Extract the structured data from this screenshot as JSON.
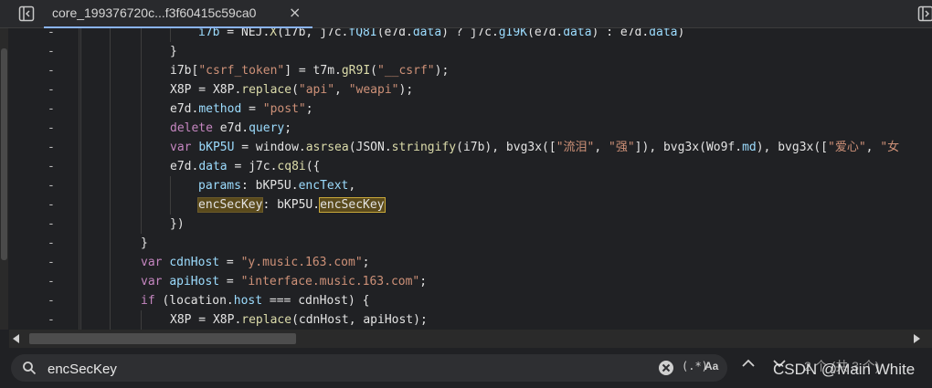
{
  "tab": {
    "title": "core_199376720c...f3f60415c59ca0",
    "close": "×"
  },
  "code_lines": [
    {
      "marker": "-",
      "tokens": [
        [
          "i7b",
          "var"
        ],
        [
          " = NEJ.",
          "plain"
        ],
        [
          "X",
          "fn"
        ],
        [
          "(i7b, j7c.",
          "plain"
        ],
        [
          "fQ8I",
          "prop"
        ],
        [
          "(e7d.",
          "plain"
        ],
        [
          "data",
          "prop"
        ],
        [
          ") ? j7c.",
          "plain"
        ],
        [
          "gI9K",
          "prop"
        ],
        [
          "(e7d.",
          "plain"
        ],
        [
          "data",
          "prop"
        ],
        [
          ") : e7d.",
          "plain"
        ],
        [
          "data",
          "prop"
        ],
        [
          ")",
          "plain"
        ]
      ]
    },
    {
      "marker": "-",
      "tokens": [
        [
          "}",
          "plain"
        ]
      ]
    },
    {
      "marker": "-",
      "tokens": [
        [
          "i7b[",
          "plain"
        ],
        [
          "\"csrf_token\"",
          "str"
        ],
        [
          "] = t7m.",
          "plain"
        ],
        [
          "gR9I",
          "fn"
        ],
        [
          "(",
          "plain"
        ],
        [
          "\"__csrf\"",
          "str"
        ],
        [
          ");",
          "plain"
        ]
      ]
    },
    {
      "marker": "-",
      "tokens": [
        [
          "X8P = X8P.",
          "plain"
        ],
        [
          "replace",
          "fn"
        ],
        [
          "(",
          "plain"
        ],
        [
          "\"api\"",
          "str"
        ],
        [
          ", ",
          "plain"
        ],
        [
          "\"weapi\"",
          "str"
        ],
        [
          ");",
          "plain"
        ]
      ]
    },
    {
      "marker": "-",
      "tokens": [
        [
          "e7d.",
          "plain"
        ],
        [
          "method",
          "prop"
        ],
        [
          " = ",
          "plain"
        ],
        [
          "\"post\"",
          "str"
        ],
        [
          ";",
          "plain"
        ]
      ]
    },
    {
      "marker": "-",
      "tokens": [
        [
          "delete",
          "kw"
        ],
        [
          " e7d.",
          "plain"
        ],
        [
          "query",
          "prop"
        ],
        [
          ";",
          "plain"
        ]
      ]
    },
    {
      "marker": "-",
      "tokens": [
        [
          "var",
          "kw"
        ],
        [
          " ",
          "plain"
        ],
        [
          "bKP5U",
          "var"
        ],
        [
          " = window.",
          "plain"
        ],
        [
          "asrsea",
          "fn"
        ],
        [
          "(JSON.",
          "plain"
        ],
        [
          "stringify",
          "fn"
        ],
        [
          "(i7b), bvg3x([",
          "plain"
        ],
        [
          "\"流泪\"",
          "str"
        ],
        [
          ", ",
          "plain"
        ],
        [
          "\"强\"",
          "str"
        ],
        [
          "]), bvg3x(Wo9f.",
          "plain"
        ],
        [
          "md",
          "prop"
        ],
        [
          "), bvg3x([",
          "plain"
        ],
        [
          "\"爱心\"",
          "str"
        ],
        [
          ", ",
          "plain"
        ],
        [
          "\"女",
          "str"
        ]
      ]
    },
    {
      "marker": "-",
      "tokens": [
        [
          "e7d.",
          "plain"
        ],
        [
          "data",
          "prop"
        ],
        [
          " = j7c.",
          "plain"
        ],
        [
          "cq8i",
          "fn"
        ],
        [
          "({",
          "plain"
        ]
      ]
    },
    {
      "marker": "-",
      "tokens": [
        [
          "params",
          "prop"
        ],
        [
          ": bKP5U.",
          "plain"
        ],
        [
          "encText",
          "prop"
        ],
        [
          ",",
          "plain"
        ]
      ]
    },
    {
      "marker": "-",
      "tokens": [
        [
          "encSecKey",
          "hl"
        ],
        [
          ": bKP5U.",
          "plain"
        ],
        [
          "encSecKey",
          "hl2"
        ]
      ]
    },
    {
      "marker": "-",
      "tokens": [
        [
          "})",
          "plain"
        ]
      ]
    },
    {
      "marker": "-",
      "tokens": [
        [
          "}",
          "plain"
        ]
      ]
    },
    {
      "marker": "-",
      "tokens": [
        [
          "var",
          "kw"
        ],
        [
          " ",
          "plain"
        ],
        [
          "cdnHost",
          "var"
        ],
        [
          " = ",
          "plain"
        ],
        [
          "\"y.music.163.com\"",
          "str"
        ],
        [
          ";",
          "plain"
        ]
      ]
    },
    {
      "marker": "-",
      "tokens": [
        [
          "var",
          "kw"
        ],
        [
          " ",
          "plain"
        ],
        [
          "apiHost",
          "var"
        ],
        [
          " = ",
          "plain"
        ],
        [
          "\"interface.music.163.com\"",
          "str"
        ],
        [
          ";",
          "plain"
        ]
      ]
    },
    {
      "marker": "-",
      "tokens": [
        [
          "if",
          "kw"
        ],
        [
          " (location.",
          "plain"
        ],
        [
          "host",
          "prop"
        ],
        [
          " === cdnHost) {",
          "plain"
        ]
      ]
    },
    {
      "marker": "-",
      "tokens": [
        [
          "X8P = X8P.",
          "plain"
        ],
        [
          "replace",
          "fn"
        ],
        [
          "(cdnHost, apiHost);",
          "plain"
        ]
      ]
    }
  ],
  "search": {
    "value": "encSecKey",
    "regex_label": "(.*)",
    "case_label": "Aa",
    "match_count": "2 个 (共 3 个)"
  },
  "watermark": "CSDN @Main White",
  "icons": {
    "sidebar_toggle": "sidebar-toggle-icon",
    "search": "search-icon",
    "clear": "clear-icon",
    "prev": "chevron-up-icon",
    "next": "chevron-down-icon"
  }
}
